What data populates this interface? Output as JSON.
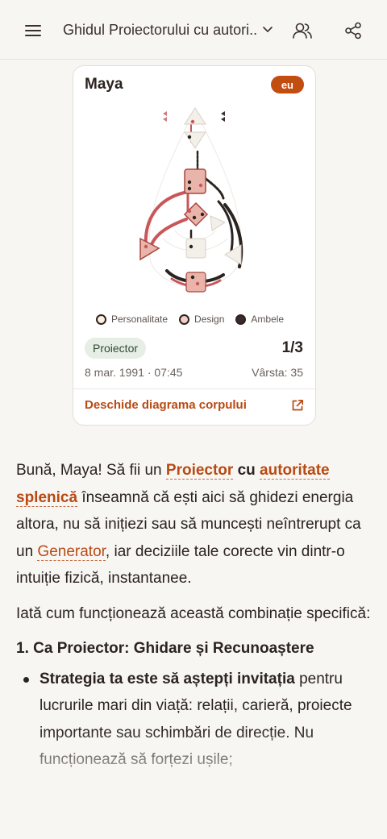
{
  "header": {
    "title": "Ghidul Proiectorului cu autori..."
  },
  "card": {
    "name": "Maya",
    "badge": "eu",
    "legend": [
      {
        "label": "Personalitate",
        "color": "#fbefe1"
      },
      {
        "label": "Design",
        "color": "#f3cfc7"
      },
      {
        "label": "Ambele",
        "color": "#3a2a28"
      }
    ],
    "type": "Proiector",
    "profile": "1/3",
    "birth": "8 mar. 1991 · 07:45",
    "age": "Vârsta: 35",
    "open_link": "Deschide diagrama corpului"
  },
  "message": {
    "p1": {
      "intro": "Bună, Maya! Să fii un ",
      "term1": "Proiector",
      "mid1": " cu ",
      "term2": "autoritate splenică",
      "mid2": " înseamnă că ești aici să ghidezi energia altora, nu să inițiezi sau să muncești neîntrerupt ca un ",
      "term3": "Generator",
      "end": ", iar deciziile tale corecte vin dintr-o intuiție fizică, instantanee."
    },
    "p2": "Iată cum funcționează această combinație specifică:",
    "section1": "1. Ca Proiector: Ghidare și Recunoaștere",
    "bullet1_bold": "Strategia ta este să aștepți invitația",
    "bullet1_text": " pentru lucrurile mari din viață: relații, carieră, proiecte importante sau schimbări de direcție. Nu funcționează să forțezi ușile;"
  },
  "colors": {
    "accent": "#c24d10",
    "link": "#b84a12",
    "defined_center": "#e9b4aa",
    "channel_design": "#c9575a",
    "channel_both": "#2b2320"
  }
}
